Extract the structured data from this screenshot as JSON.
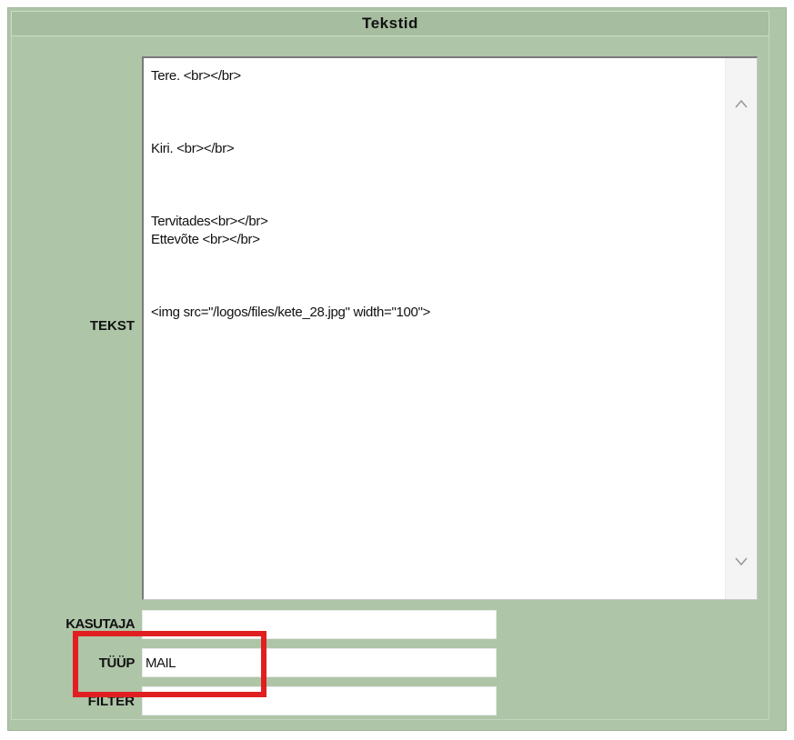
{
  "panel": {
    "title": "Tekstid"
  },
  "form": {
    "tekst_label": "TEKST",
    "tekst_lines": [
      "Tere. <br></br>",
      "",
      "",
      "",
      "Kiri. <br></br>",
      "",
      "",
      "",
      "Tervitades<br></br>",
      "Ettevõte <br></br>",
      "",
      "",
      "",
      "<img src=\"/logos/files/kete_28.jpg\" width=\"100\">"
    ],
    "kasutaja_label": "KASUTAJA",
    "kasutaja_value": "",
    "tyyp_label": "TÜÜP",
    "tyyp_value": "MAIL",
    "filter_label": "FILTER",
    "filter_value": ""
  },
  "colors": {
    "panel_background": "#aec5a8",
    "highlight": "#e02020"
  },
  "icons": {
    "scroll_up": "chevron-up-icon",
    "scroll_down": "chevron-down-icon"
  }
}
